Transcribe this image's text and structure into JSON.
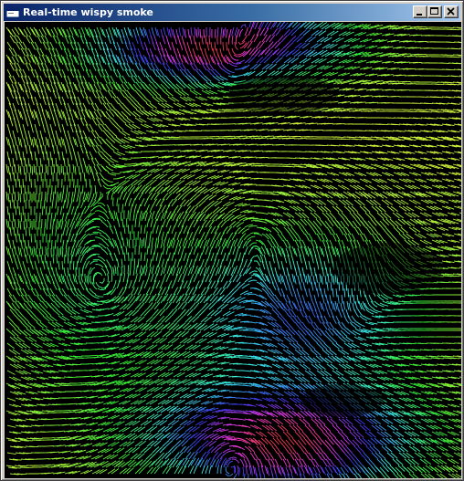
{
  "window": {
    "title": "Real-time wispy smoke",
    "icon": "app-window-icon"
  },
  "title_buttons": [
    {
      "name": "minimize-icon"
    },
    {
      "name": "maximize-icon"
    },
    {
      "name": "close-icon"
    }
  ],
  "visualization": {
    "background": "#000000",
    "palette": [
      "#ff4a5a",
      "#ffb84a",
      "#c8ff3a",
      "#44ff77",
      "#22cfcf",
      "#3858ff",
      "#9a4ad8"
    ]
  }
}
